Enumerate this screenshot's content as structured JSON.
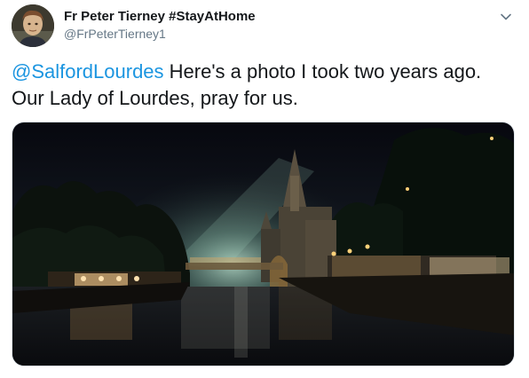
{
  "tweet": {
    "author": {
      "name": "Fr Peter Tierney #StayAtHome",
      "handle": "@FrPeterTierney1"
    },
    "text": {
      "mention": "@SalfordLourdes",
      "body": " Here's a photo I took two years ago. Our Lady of Lourdes, pray for us."
    },
    "icons": {
      "more": "chevron-down-icon",
      "avatar": "avatar"
    },
    "colors": {
      "link": "#1b95e0",
      "text": "#14171a",
      "secondary": "#657786"
    }
  }
}
